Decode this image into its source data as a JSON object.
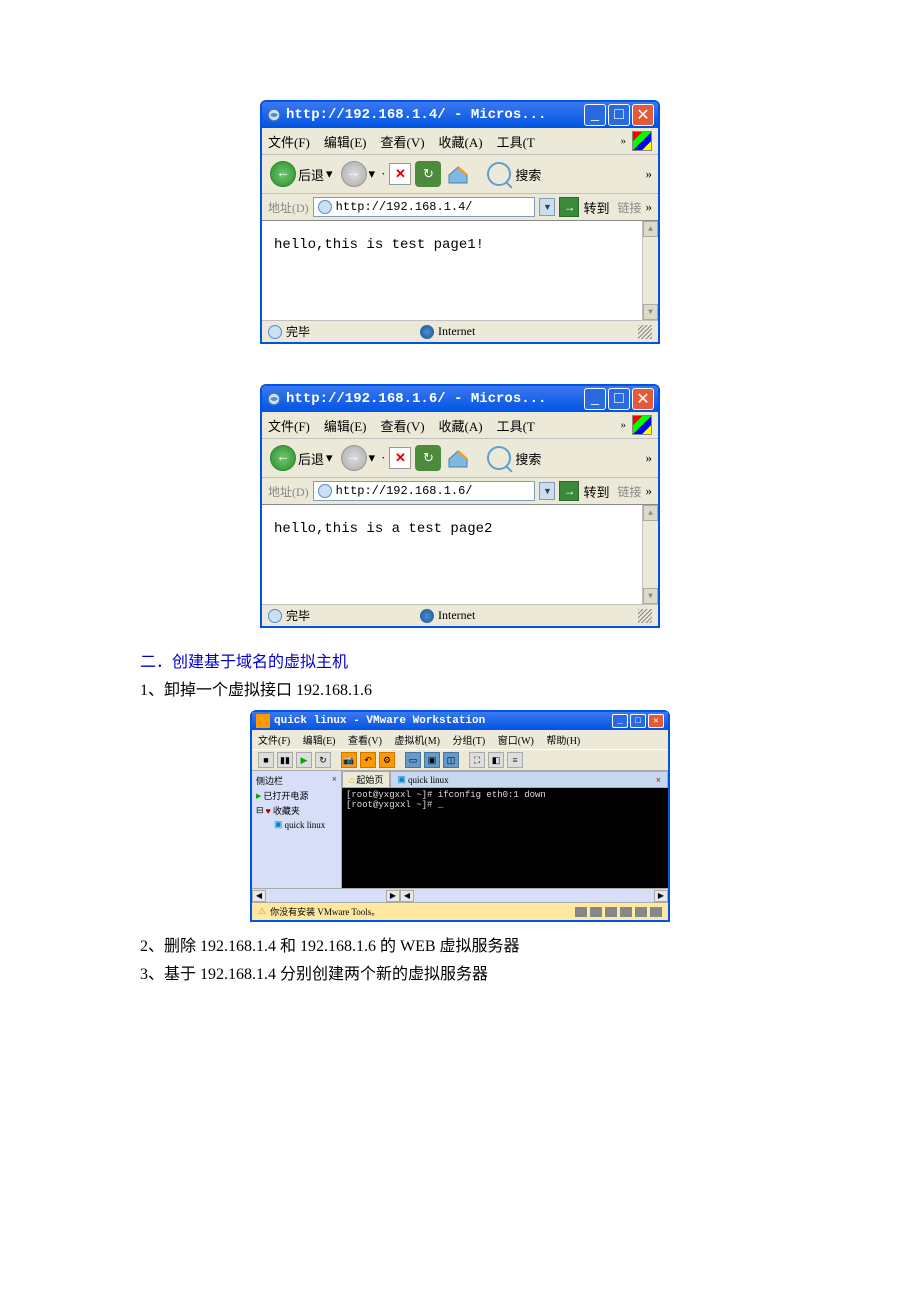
{
  "browser1": {
    "title": "http://192.168.1.4/ - Micros...",
    "menus": {
      "file": "文件(F)",
      "edit": "编辑(E)",
      "view": "查看(V)",
      "fav": "收藏(A)",
      "tools": "工具(T",
      "more": "»"
    },
    "toolbar": {
      "back": "后退",
      "search": "搜索",
      "more": "»"
    },
    "addr": {
      "label": "地址(D)",
      "url": "http://192.168.1.4/",
      "go": "转到",
      "links": "链接",
      "more": "»"
    },
    "content": "hello,this is test page1!",
    "status": "完毕",
    "zone": "Internet"
  },
  "browser2": {
    "title": "http://192.168.1.6/ - Micros...",
    "menus": {
      "file": "文件(F)",
      "edit": "编辑(E)",
      "view": "查看(V)",
      "fav": "收藏(A)",
      "tools": "工具(T",
      "more": "»"
    },
    "toolbar": {
      "back": "后退",
      "search": "搜索",
      "more": "»"
    },
    "addr": {
      "label": "地址(D)",
      "url": "http://192.168.1.6/",
      "go": "转到",
      "links": "链接",
      "more": "»"
    },
    "content": "hello,this is a test page2",
    "status": "完毕",
    "zone": "Internet"
  },
  "section2": {
    "num": "二．",
    "title": "创建基于域名的虚拟主机"
  },
  "step1": "1、卸掉一个虚拟接口 192.168.1.6",
  "vmware": {
    "title": "quick linux - VMware Workstation",
    "menus": {
      "file": "文件(F)",
      "edit": "编辑(E)",
      "view": "查看(V)",
      "vm": "虚拟机(M)",
      "group": "分组(T)",
      "window": "窗口(W)",
      "help": "帮助(H)"
    },
    "sidebar": {
      "title": "侧边栏",
      "powered": "已打开电源",
      "fav": "收藏夹",
      "item": "quick linux"
    },
    "tabs": {
      "home": "起始页",
      "active": "quick linux"
    },
    "terminal_line1": "[root@yxgxxl ~]# ifconfig eth0:1 down",
    "terminal_line2": "[root@yxgxxl ~]# _",
    "status": "你没有安装 VMware Tools。"
  },
  "step2": "2、删除 192.168.1.4 和 192.168.1.6 的 WEB 虚拟服务器",
  "step3": "3、基于 192.168.1.4 分别创建两个新的虚拟服务器"
}
